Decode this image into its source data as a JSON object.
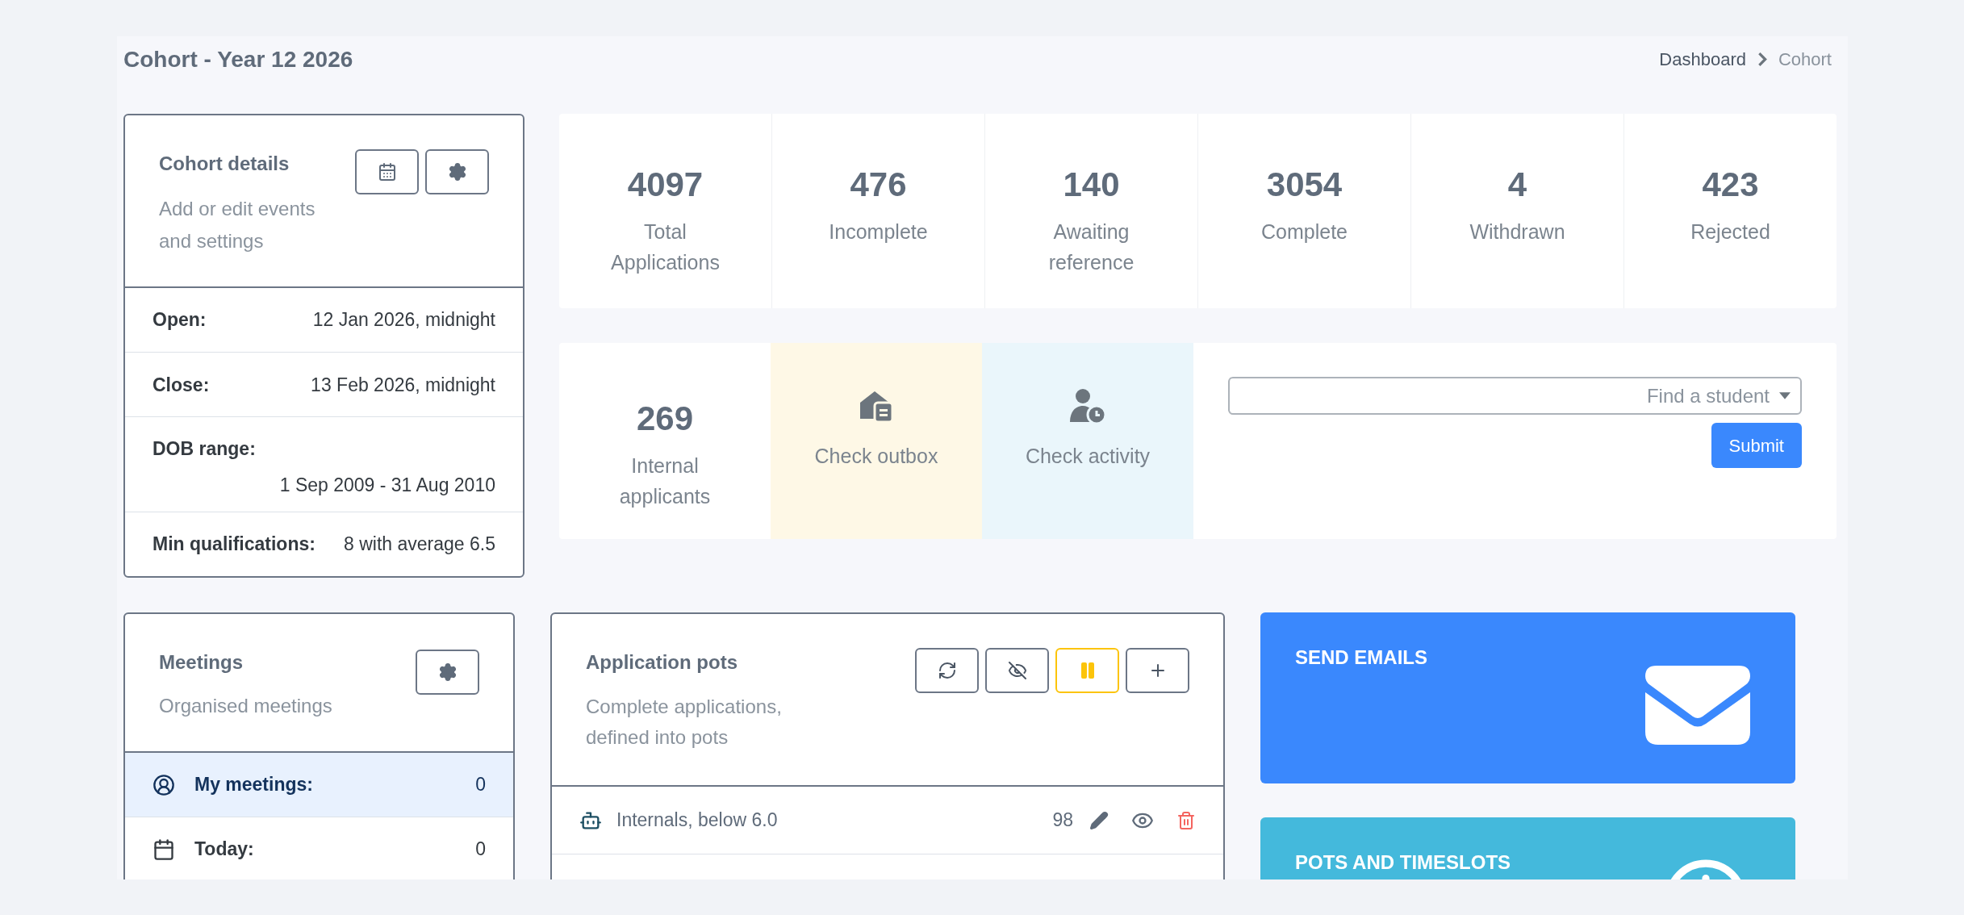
{
  "page": {
    "title": "Cohort - Year 12 2026"
  },
  "breadcrumb": [
    {
      "label": "Dashboard",
      "link": true
    },
    {
      "label": "Cohort",
      "link": false
    }
  ],
  "cohort_details": {
    "title": "Cohort details",
    "subtitle": "Add or edit events and settings",
    "rows": [
      {
        "label": "Open:",
        "value": "12 Jan 2026, midnight",
        "kind": "inline"
      },
      {
        "label": "Close:",
        "value": "13 Feb 2026, midnight",
        "kind": "inline"
      },
      {
        "label": "DOB range:",
        "value": "1 Sep 2009 - 31 Aug 2010",
        "kind": "stacked"
      },
      {
        "label": "Min qualifications:",
        "value": "8 with average 6.5",
        "kind": "inline"
      }
    ]
  },
  "stats": [
    {
      "value": "4097",
      "label": "Total Applications"
    },
    {
      "value": "476",
      "label": "Incomplete"
    },
    {
      "value": "140",
      "label": "Awaiting reference"
    },
    {
      "value": "3054",
      "label": "Complete"
    },
    {
      "value": "4",
      "label": "Withdrawn"
    },
    {
      "value": "423",
      "label": "Rejected"
    }
  ],
  "quick_tiles": [
    {
      "kind": "stat",
      "value": "269",
      "label": "Internal applicants"
    },
    {
      "kind": "outbox",
      "label": "Check outbox",
      "color": "#fef8e6"
    },
    {
      "kind": "activity",
      "label": "Check activity",
      "color": "#eaf6fb"
    }
  ],
  "student_search": {
    "placeholder": "Find a student",
    "button": "Submit"
  },
  "meetings": {
    "title": "Meetings",
    "subtitle": "Organised meetings",
    "rows": [
      {
        "kind": "mine",
        "label": "My meetings:",
        "count": "0",
        "selected": true
      },
      {
        "kind": "today",
        "label": "Today:",
        "count": "0",
        "selected": false
      }
    ]
  },
  "application_pots": {
    "title": "Application pots",
    "subtitle": "Complete applications, defined into pots",
    "toolbar": [
      {
        "kind": "refresh",
        "active": false
      },
      {
        "kind": "hide",
        "active": false
      },
      {
        "kind": "pause",
        "active": true
      },
      {
        "kind": "add",
        "active": false
      }
    ],
    "rows": [
      {
        "label": "Internals, below 6.0",
        "count": "98"
      }
    ]
  },
  "action_tiles": [
    {
      "kind": "email",
      "label": "SEND EMAILS",
      "color": "#3a88fd"
    },
    {
      "kind": "slots",
      "label": "POTS AND TIMESLOTS",
      "color": "#44b9dc"
    }
  ]
}
